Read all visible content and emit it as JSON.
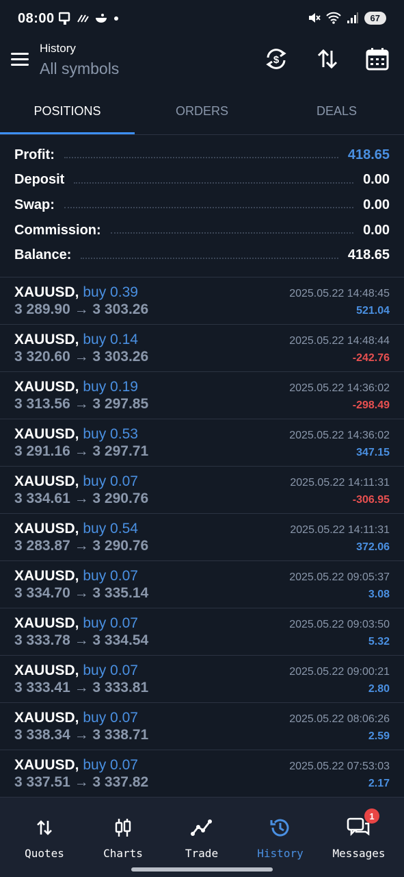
{
  "status": {
    "time": "08:00",
    "battery": "67"
  },
  "header": {
    "title": "History",
    "subtitle": "All symbols"
  },
  "tabs": [
    {
      "label": "POSITIONS",
      "active": true
    },
    {
      "label": "ORDERS",
      "active": false
    },
    {
      "label": "DEALS",
      "active": false
    }
  ],
  "summary": [
    {
      "label": "Profit:",
      "value": "418.65",
      "highlight": true
    },
    {
      "label": "Deposit",
      "value": "0.00",
      "highlight": false
    },
    {
      "label": "Swap:",
      "value": "0.00",
      "highlight": false
    },
    {
      "label": "Commission:",
      "value": "0.00",
      "highlight": false
    },
    {
      "label": "Balance:",
      "value": "418.65",
      "highlight": false
    }
  ],
  "positions": [
    {
      "symbol": "XAUUSD,",
      "side": "buy 0.39",
      "prices": "3 289.90 → 3 303.26",
      "time": "2025.05.22 14:48:45",
      "profit": "521.04",
      "negative": false
    },
    {
      "symbol": "XAUUSD,",
      "side": "buy 0.14",
      "prices": "3 320.60 → 3 303.26",
      "time": "2025.05.22 14:48:44",
      "profit": "-242.76",
      "negative": true
    },
    {
      "symbol": "XAUUSD,",
      "side": "buy 0.19",
      "prices": "3 313.56 → 3 297.85",
      "time": "2025.05.22 14:36:02",
      "profit": "-298.49",
      "negative": true
    },
    {
      "symbol": "XAUUSD,",
      "side": "buy 0.53",
      "prices": "3 291.16 → 3 297.71",
      "time": "2025.05.22 14:36:02",
      "profit": "347.15",
      "negative": false
    },
    {
      "symbol": "XAUUSD,",
      "side": "buy 0.07",
      "prices": "3 334.61 → 3 290.76",
      "time": "2025.05.22 14:11:31",
      "profit": "-306.95",
      "negative": true
    },
    {
      "symbol": "XAUUSD,",
      "side": "buy 0.54",
      "prices": "3 283.87 → 3 290.76",
      "time": "2025.05.22 14:11:31",
      "profit": "372.06",
      "negative": false
    },
    {
      "symbol": "XAUUSD,",
      "side": "buy 0.07",
      "prices": "3 334.70 → 3 335.14",
      "time": "2025.05.22 09:05:37",
      "profit": "3.08",
      "negative": false
    },
    {
      "symbol": "XAUUSD,",
      "side": "buy 0.07",
      "prices": "3 333.78 → 3 334.54",
      "time": "2025.05.22 09:03:50",
      "profit": "5.32",
      "negative": false
    },
    {
      "symbol": "XAUUSD,",
      "side": "buy 0.07",
      "prices": "3 333.41 → 3 333.81",
      "time": "2025.05.22 09:00:21",
      "profit": "2.80",
      "negative": false
    },
    {
      "symbol": "XAUUSD,",
      "side": "buy 0.07",
      "prices": "3 338.34 → 3 338.71",
      "time": "2025.05.22 08:06:26",
      "profit": "2.59",
      "negative": false
    },
    {
      "symbol": "XAUUSD,",
      "side": "buy 0.07",
      "prices": "3 337.51 → 3 337.82",
      "time": "2025.05.22 07:53:03",
      "profit": "2.17",
      "negative": false
    }
  ],
  "nav": [
    {
      "label": "Quotes",
      "icon": "quotes-arrows-icon",
      "active": false
    },
    {
      "label": "Charts",
      "icon": "candlestick-icon",
      "active": false
    },
    {
      "label": "Trade",
      "icon": "trade-line-icon",
      "active": false
    },
    {
      "label": "History",
      "icon": "history-clock-icon",
      "active": true
    },
    {
      "label": "Messages",
      "icon": "messages-icon",
      "active": false,
      "badge": "1"
    }
  ],
  "colors": {
    "background": "#131a25",
    "accent": "#4a90e2",
    "loss": "#e85050",
    "muted": "#8a97ab"
  }
}
